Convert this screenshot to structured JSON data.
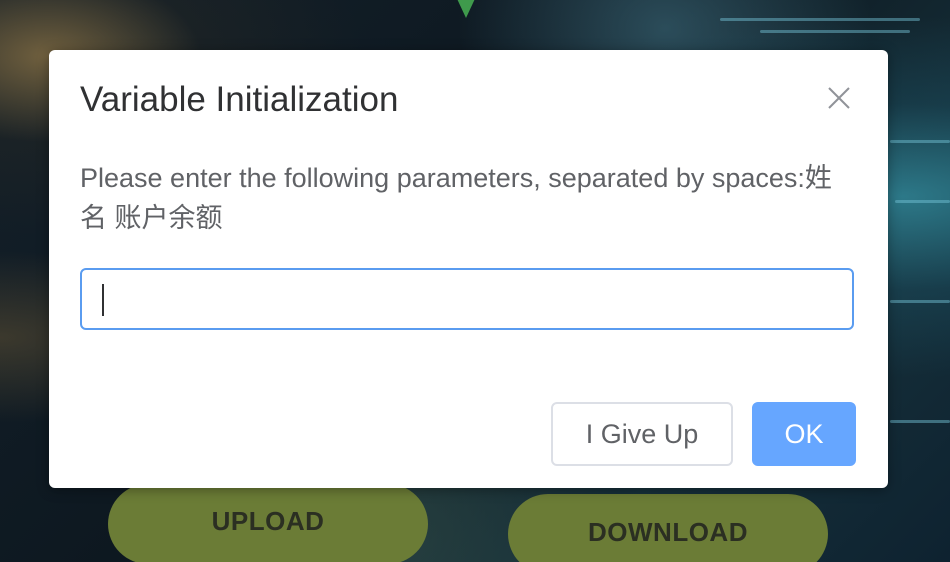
{
  "background": {
    "upload_label": "UPLOAD",
    "download_label": "DOWNLOAD",
    "button_color": "#6b7c36"
  },
  "dialog": {
    "title": "Variable Initialization",
    "message": "Please enter the following parameters, separated by spaces:姓名 账户余额",
    "input": {
      "value": "",
      "placeholder": ""
    },
    "cancel_label": "I Give Up",
    "ok_label": "OK",
    "close_icon": "close-icon",
    "accent_color": "#66a6ff"
  }
}
